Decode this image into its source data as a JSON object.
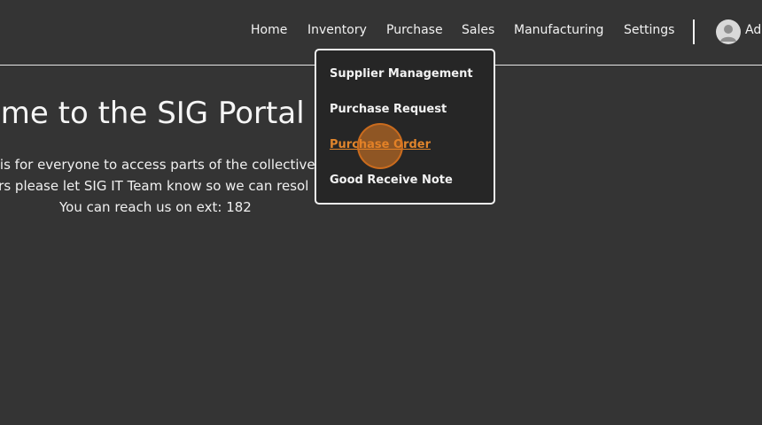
{
  "nav": {
    "items": [
      {
        "label": "Home"
      },
      {
        "label": "Inventory"
      },
      {
        "label": "Purchase"
      },
      {
        "label": "Sales"
      },
      {
        "label": "Manufacturing"
      },
      {
        "label": "Settings"
      }
    ],
    "user": {
      "name": "Adm",
      "icon": "user-avatar-icon"
    }
  },
  "hero": {
    "title": "ome to the SIG Portal",
    "line1": "l is for everyone to access parts of the collective",
    "line2": "ors please let SIG IT Team know so we can resol",
    "line3": "You can reach us on ext: 182"
  },
  "purchase_menu": {
    "items": [
      {
        "label": "Supplier Management"
      },
      {
        "label": "Purchase Request"
      },
      {
        "label": "Purchase Order",
        "state": "hovered"
      },
      {
        "label": "Good Receive Note"
      }
    ]
  },
  "colors": {
    "background": "#343434",
    "menu_background": "#262626",
    "accent": "#e0852c",
    "text": "#f2f2f2"
  }
}
